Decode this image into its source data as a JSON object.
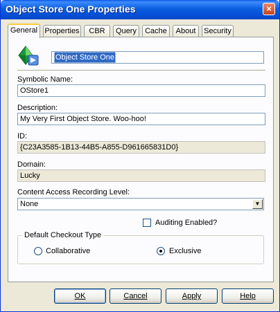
{
  "window": {
    "title": "Object Store One Properties",
    "close_glyph": "×"
  },
  "tabs": [
    "General",
    "Properties",
    "CBR",
    "Query",
    "Cache",
    "About",
    "Security"
  ],
  "general": {
    "icon": "object-store-icon",
    "name_value": "Object Store One",
    "symbolic_name_label": "Symbolic Name:",
    "symbolic_name_value": "OStore1",
    "description_label": "Description:",
    "description_value": "My Very First Object Store.  Woo-hoo!",
    "id_label": "ID:",
    "id_value": "{C23A3585-1B13-44B5-A855-D961665831D0}",
    "domain_label": "Domain:",
    "domain_value": "Lucky",
    "content_access_label": "Content Access Recording Level:",
    "content_access_value": "None",
    "auditing_label": "Auditing Enabled?",
    "auditing_checked": false,
    "checkout_group_title": "Default Checkout Type",
    "collaborative_label": "Collaborative",
    "exclusive_label": "Exclusive",
    "selected_checkout": "Exclusive"
  },
  "buttons": {
    "ok": "OK",
    "cancel": "Cancel",
    "apply": "Apply",
    "help": "Help"
  }
}
